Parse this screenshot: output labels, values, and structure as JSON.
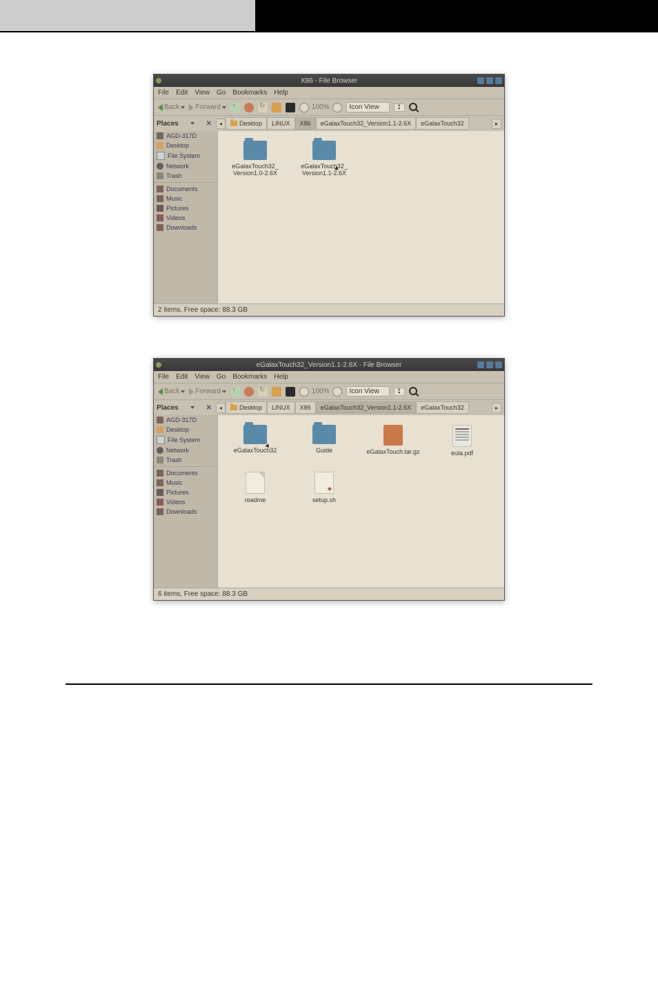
{
  "browser1": {
    "title": "X86 - File Browser",
    "menu": {
      "file": "File",
      "edit": "Edit",
      "view": "View",
      "go": "Go",
      "bookmarks": "Bookmarks",
      "help": "Help"
    },
    "toolbar": {
      "back": "Back",
      "forward": "Forward",
      "zoom": "100%",
      "view_mode": "Icon View"
    },
    "places_label": "Places",
    "path": [
      {
        "label": "Desktop",
        "active": false,
        "has_icon": true
      },
      {
        "label": "LINUX",
        "active": false
      },
      {
        "label": "X86",
        "active": true
      },
      {
        "label": "eGalaxTouch32_Version1.1-2.6X",
        "active": false
      },
      {
        "label": "eGalaxTouch32",
        "active": false
      }
    ],
    "sidebar": [
      {
        "label": "AGD-317D",
        "icon": "ico-drive"
      },
      {
        "label": "Desktop",
        "icon": "ico-folder"
      },
      {
        "label": "File System",
        "icon": "ico-filesys"
      },
      {
        "label": "Network",
        "icon": "ico-network"
      },
      {
        "label": "Trash",
        "icon": "ico-trash"
      }
    ],
    "sidebar2": [
      {
        "label": "Documents",
        "icon": "ico-doc"
      },
      {
        "label": "Music",
        "icon": "ico-music"
      },
      {
        "label": "Pictures",
        "icon": "ico-pic"
      },
      {
        "label": "Videos",
        "icon": "ico-vid"
      },
      {
        "label": "Downloads",
        "icon": "ico-down"
      }
    ],
    "files": [
      {
        "label": "eGalaxTouch32_\nVersion1.0-2.6X",
        "type": "folder"
      },
      {
        "label": "eGalaxTouch32_\nVersion1.1-2.6X",
        "type": "folder",
        "cursor": true
      }
    ],
    "status": "2 items, Free space: 88.3 GB"
  },
  "browser2": {
    "title": "eGalaxTouch32_Version1.1-2.6X - File Browser",
    "menu": {
      "file": "File",
      "edit": "Edit",
      "view": "View",
      "go": "Go",
      "bookmarks": "Bookmarks",
      "help": "Help"
    },
    "toolbar": {
      "back": "Back",
      "forward": "Forward",
      "zoom": "100%",
      "view_mode": "Icon View"
    },
    "places_label": "Places",
    "path": [
      {
        "label": "Desktop",
        "active": false,
        "has_icon": true
      },
      {
        "label": "LINUX",
        "active": false
      },
      {
        "label": "X86",
        "active": false
      },
      {
        "label": "eGalaxTouch32_Version1.1-2.6X",
        "active": true
      },
      {
        "label": "eGalaxTouch32",
        "active": false
      }
    ],
    "sidebar": [
      {
        "label": "AGD-317D",
        "icon": "ico-drive"
      },
      {
        "label": "Desktop",
        "icon": "ico-folder"
      },
      {
        "label": "File System",
        "icon": "ico-filesys"
      },
      {
        "label": "Network",
        "icon": "ico-network"
      },
      {
        "label": "Trash",
        "icon": "ico-trash"
      }
    ],
    "sidebar2": [
      {
        "label": "Documents",
        "icon": "ico-doc"
      },
      {
        "label": "Music",
        "icon": "ico-music"
      },
      {
        "label": "Pictures",
        "icon": "ico-pic"
      },
      {
        "label": "Videos",
        "icon": "ico-vid"
      },
      {
        "label": "Downloads",
        "icon": "ico-down"
      }
    ],
    "files": [
      {
        "label": "eGalaxTouch32",
        "type": "folder",
        "cursor": true
      },
      {
        "label": "Guide",
        "type": "folder"
      },
      {
        "label": "eGalaxTouch.tar.gz",
        "type": "archive"
      },
      {
        "label": "eula.pdf",
        "type": "doc"
      },
      {
        "label": "readme",
        "type": "plain"
      },
      {
        "label": "setup.sh",
        "type": "script"
      }
    ],
    "status": "6 items, Free space: 88.3 GB"
  }
}
